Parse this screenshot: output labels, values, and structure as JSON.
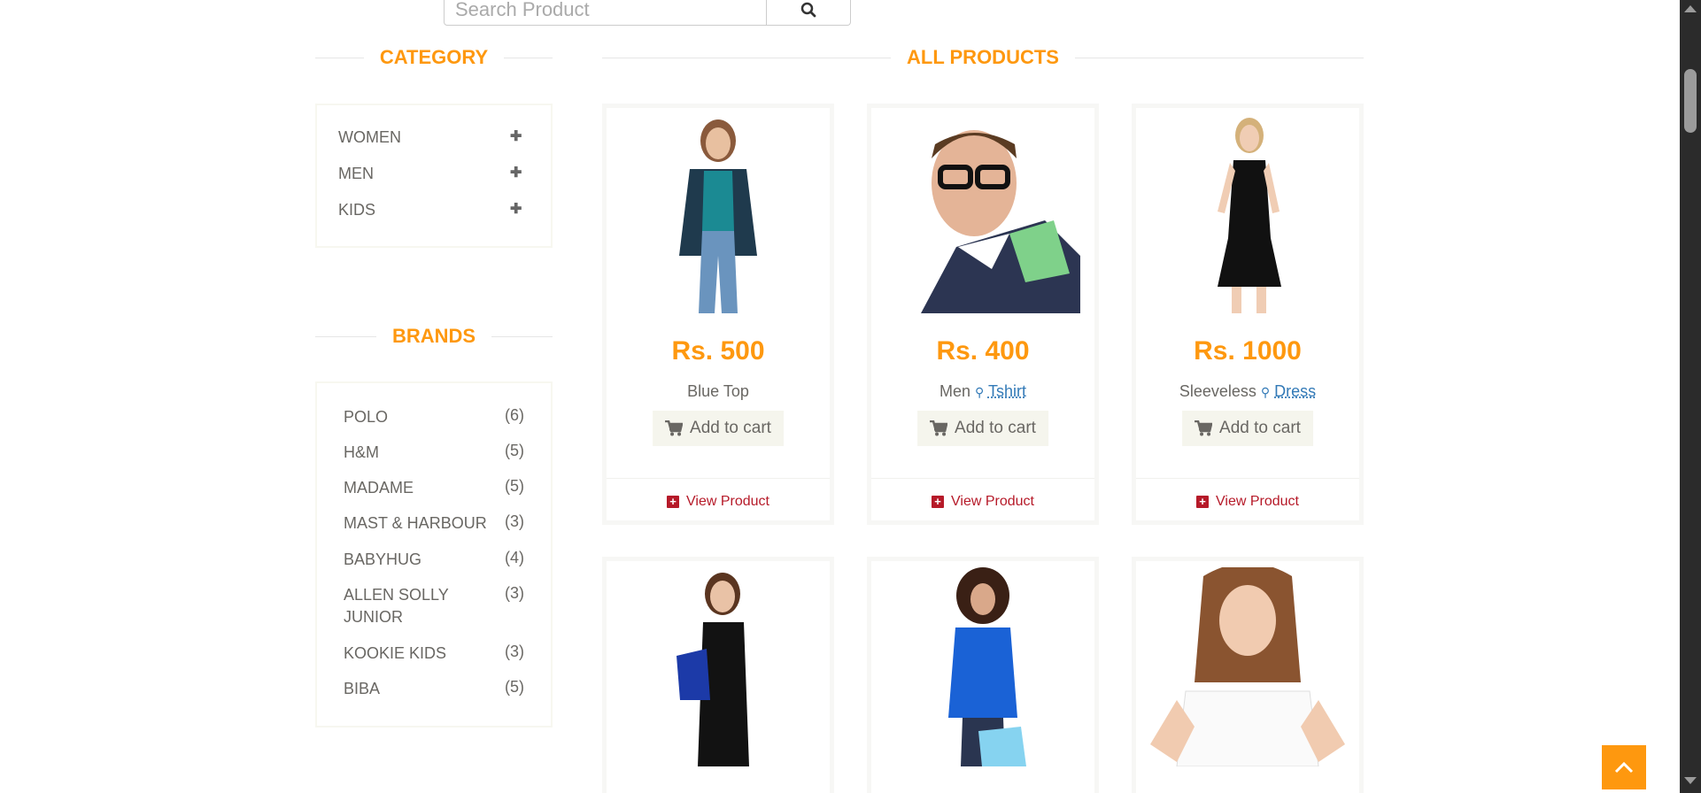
{
  "search": {
    "placeholder": "Search Product",
    "button_icon": "search-icon"
  },
  "category": {
    "title": "CATEGORY",
    "items": [
      {
        "label": "WOMEN"
      },
      {
        "label": "MEN"
      },
      {
        "label": "KIDS"
      }
    ]
  },
  "brands": {
    "title": "BRANDS",
    "items": [
      {
        "label": "POLO",
        "count": "(6)"
      },
      {
        "label": "H&M",
        "count": "(5)"
      },
      {
        "label": "MADAME",
        "count": "(5)"
      },
      {
        "label": "MAST & HARBOUR",
        "count": "(3)"
      },
      {
        "label": "BABYHUG",
        "count": "(4)"
      },
      {
        "label": "ALLEN SOLLY JUNIOR",
        "count": "(3)"
      },
      {
        "label": "KOOKIE KIDS",
        "count": "(3)"
      },
      {
        "label": "BIBA",
        "count": "(5)"
      }
    ]
  },
  "products": {
    "title": "ALL PRODUCTS",
    "add_to_cart": "Add to cart",
    "view_product": "View Product",
    "items": [
      {
        "price": "Rs. 500",
        "name_pre": "Blue Top",
        "name_link": ""
      },
      {
        "price": "Rs. 400",
        "name_pre": "Men",
        "name_link": "Tshirt"
      },
      {
        "price": "Rs. 1000",
        "name_pre": "Sleeveless",
        "name_link": "Dress"
      }
    ]
  },
  "colors": {
    "accent": "#FE980F",
    "view_link": "#B61A29",
    "link": "#337ab7"
  }
}
